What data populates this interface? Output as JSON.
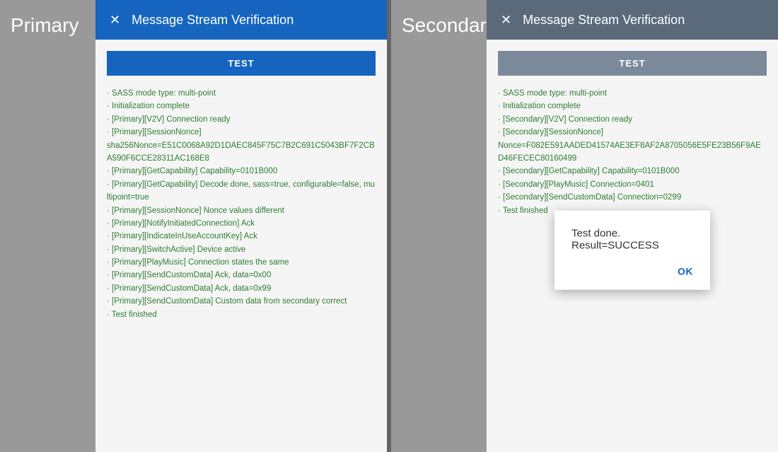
{
  "left": {
    "panel_title": "Primary",
    "dialog_header_title": "Message Stream Verification",
    "test_button_label": "TEST",
    "close_icon": "✕",
    "log_lines": "· SASS mode type: multi-point\n· Initialization complete\n· [Primary][V2V] Connection ready\n· [Primary][SessionNonce]\nsha256Nonce=E51C0068A92D1DAEC845F75C7B2C691C5043BF7F2CBA590F6CCE28311AC168E8\n· [Primary][GetCapability] Capability=0101B000\n· [Primary][GetCapability] Decode done, sass=true, configurable=false, multipoint=true\n· [Primary][SessionNonce] Nonce values different\n· [Primary][NotifyInitiatedConnection] Ack\n· [Primary][IndicateInUseAccountKey] Ack\n· [Primary][SwitchActive] Device active\n· [Primary][PlayMusic] Connection states the same\n· [Primary][SendCustomData] Ack, data=0x00\n· [Primary][SendCustomData] Ack, data=0x99\n· [Primary][SendCustomData] Custom data from secondary correct\n· Test finished"
  },
  "right": {
    "panel_title": "Secondary",
    "dialog_header_title": "Message Stream Verification",
    "test_button_label": "TEST",
    "close_icon": "✕",
    "log_lines": "· SASS mode type: multi-point\n· Initialization complete\n· [Secondary][V2V] Connection ready\n· [Secondary][SessionNonce]\nNonce=F082E591AADED41574AE3EF8AF2A8705056E5FE23B56F9AED46FECEC80160499\n· [Secondary][GetCapability] Capability=0101B000\n· [Secondary][PlayMusic] Connection=0401\n· [Secondary][SendCustomData] Connection=0299\n· Test finished",
    "result_dialog": {
      "message": "Test done. Result=SUCCESS",
      "ok_label": "OK"
    }
  }
}
